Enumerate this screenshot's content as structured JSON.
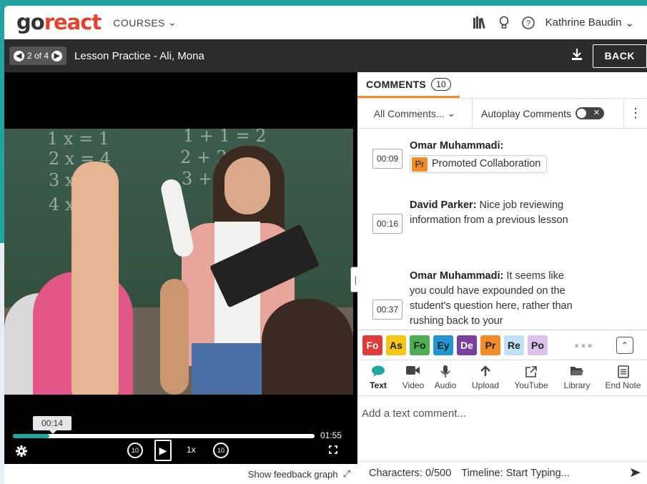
{
  "nav": {
    "logo_prefix": "go",
    "logo_suffix": "react",
    "courses_label": "COURSES",
    "user_name": "Kathrine Baudin"
  },
  "header": {
    "pager_label": "2 of 4",
    "lesson_title": "Lesson Practice - Ali, Mona",
    "back_label": "BACK"
  },
  "video": {
    "current_time": "00:14",
    "duration": "01:55",
    "progress": 0.12,
    "speed": "1x",
    "skip_back": "10",
    "skip_forward": "10",
    "feedback_label": "Show feedback graph",
    "chalk_lines": [
      "1 x  = 1",
      "2 x  = 4",
      "3 x",
      "4 x",
      "1 + 1 = 2",
      "2 + 2 =",
      "3 + 3"
    ]
  },
  "comments_panel": {
    "tab_label": "COMMENTS",
    "count": "10",
    "filter_label": "All Comments...",
    "autoplay_label": "Autoplay Comments",
    "comments": [
      {
        "time": "00:09",
        "author": "Omar Muhammadi:",
        "text": "",
        "marker_code": "Pr",
        "marker_label": "Promoted Collaboration"
      },
      {
        "time": "00:16",
        "author": "David Parker:",
        "text": " Nice job reviewing information from a previous lesson"
      },
      {
        "time": "00:37",
        "author": "Omar Muhammadi:",
        "text": " It seems like you could have expounded on the student's question here, rather than rushing back to your"
      }
    ],
    "markers": [
      {
        "code": "Fo",
        "bg": "#e03a3a",
        "fg": "#ffffff"
      },
      {
        "code": "As",
        "bg": "#f5c518",
        "fg": "#222222"
      },
      {
        "code": "Fo",
        "bg": "#4caf50",
        "fg": "#222222"
      },
      {
        "code": "Ey",
        "bg": "#2196d3",
        "fg": "#222222"
      },
      {
        "code": "De",
        "bg": "#7b3fa0",
        "fg": "#ffffff"
      },
      {
        "code": "Pr",
        "bg": "#f28c28",
        "fg": "#222222"
      },
      {
        "code": "Re",
        "bg": "#bfe3f5",
        "fg": "#222222"
      },
      {
        "code": "Po",
        "bg": "#d9c3ea",
        "fg": "#222222"
      }
    ],
    "tools": [
      {
        "label": "Text",
        "icon": "speech-bubble-icon"
      },
      {
        "label": "Video",
        "icon": "video-camera-icon"
      },
      {
        "label": "Audio",
        "icon": "microphone-icon"
      },
      {
        "label": "Upload",
        "icon": "upload-arrow-icon"
      },
      {
        "label": "YouTube",
        "icon": "external-link-icon"
      },
      {
        "label": "Library",
        "icon": "folder-icon"
      },
      {
        "label": "End Note",
        "icon": "note-icon"
      }
    ],
    "input_placeholder": "Add a text comment...",
    "characters_label": "Characters: 0/500",
    "timeline_label": "Timeline:  Start Typing..."
  },
  "colors": {
    "brand_red": "#e8402f",
    "accent_teal": "#1fa8a0",
    "tab_underline": "#f28c28",
    "dark_header": "#2c2c2c"
  }
}
